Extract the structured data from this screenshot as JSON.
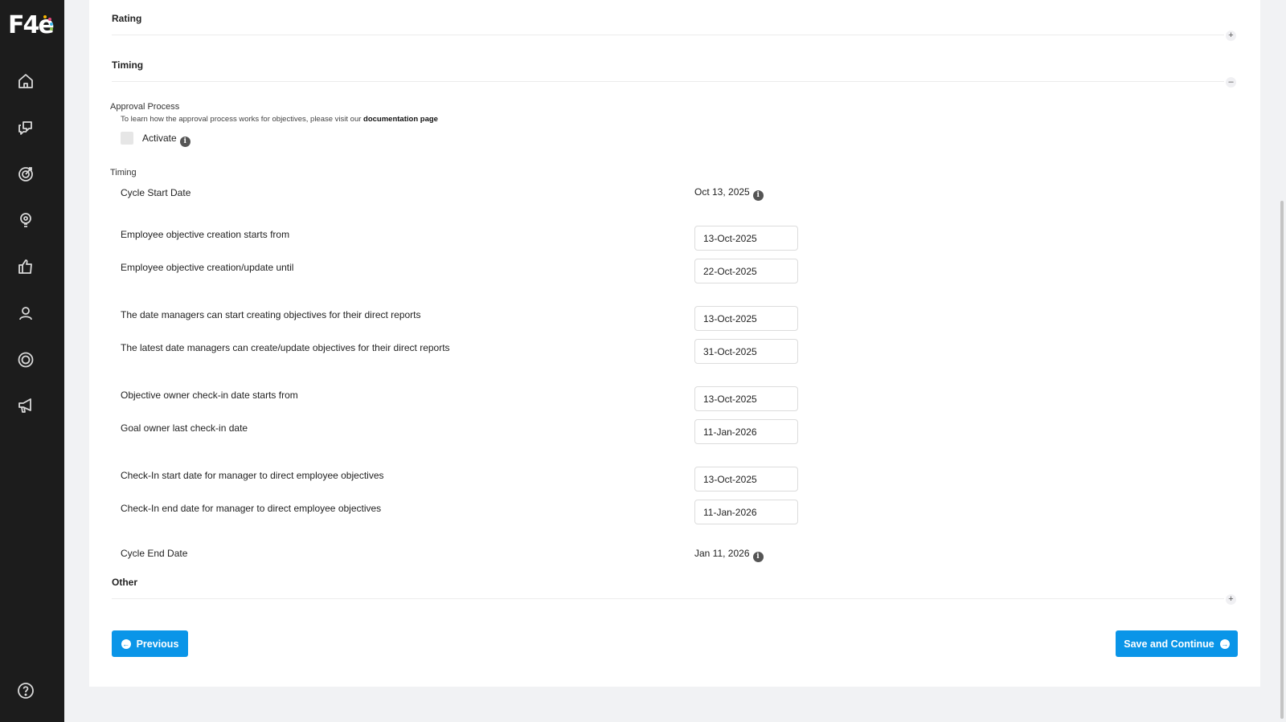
{
  "app": {
    "logo_text": "F4e",
    "logo_dot_colors": [
      "#f5b400",
      "#e84a7f",
      "#3bb5e8",
      "#8bc34a"
    ]
  },
  "sidebar": {
    "items": [
      {
        "name": "home-icon"
      },
      {
        "name": "chat-icon"
      },
      {
        "name": "target-icon"
      },
      {
        "name": "lightbulb-icon"
      },
      {
        "name": "thumbs-up-icon"
      },
      {
        "name": "users-icon"
      },
      {
        "name": "settings-icon"
      },
      {
        "name": "megaphone-icon"
      },
      {
        "name": "help-icon"
      }
    ]
  },
  "sections": {
    "rating": {
      "title": "Rating",
      "toggle": "+"
    },
    "timing": {
      "title": "Timing",
      "toggle": "–"
    },
    "other": {
      "title": "Other",
      "toggle": "+"
    }
  },
  "approval": {
    "title": "Approval Process",
    "help_prefix": "To learn how the approval process works for objectives, please visit our",
    "help_link": "documentation page",
    "checkbox_label": "Activate",
    "info": "i"
  },
  "timing": {
    "subtitle": "Timing",
    "cycle_start_label": "Cycle Start Date",
    "cycle_start_value": "Oct 13, 2025",
    "cycle_end_label": "Cycle End Date",
    "cycle_end_value": "Jan 11, 2026",
    "rows": [
      {
        "label": "Employee objective creation starts from",
        "value": "13-Oct-2025"
      },
      {
        "label": "Employee objective creation/update until",
        "value": "22-Oct-2025"
      },
      {
        "label": "The date managers can start creating objectives for their direct reports",
        "value": "13-Oct-2025"
      },
      {
        "label": "The latest date managers can create/update objectives for their direct reports",
        "value": "31-Oct-2025"
      },
      {
        "label": "Objective owner check-in date starts from",
        "value": "13-Oct-2025"
      },
      {
        "label": "Goal owner last check-in date",
        "value": "11-Jan-2026"
      },
      {
        "label": "Check-In start date for manager to direct employee objectives",
        "value": "13-Oct-2025"
      },
      {
        "label": "Check-In end date for manager to direct employee objectives",
        "value": "11-Jan-2026"
      }
    ]
  },
  "footer": {
    "previous_label": "Previous",
    "save_label": "Save and Continue"
  }
}
